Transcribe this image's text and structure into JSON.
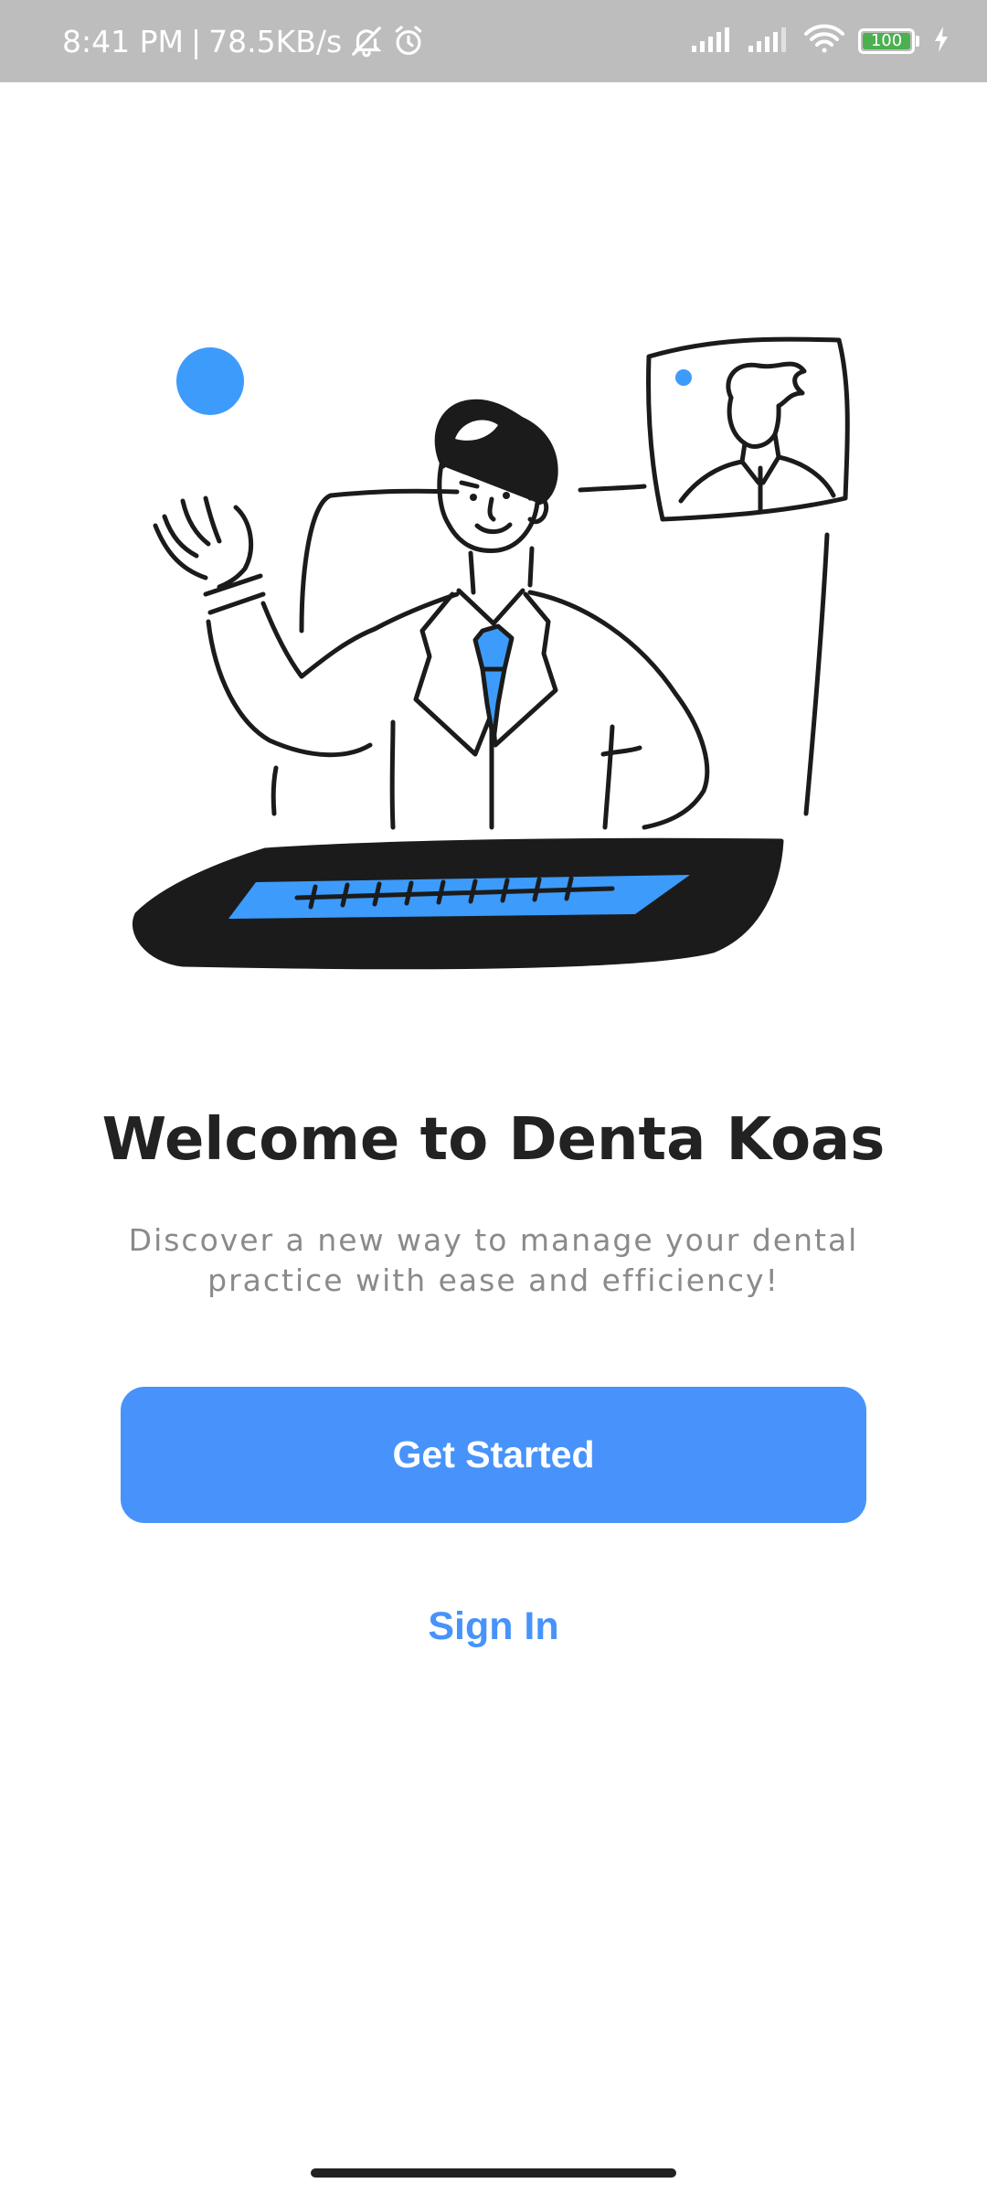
{
  "status_bar": {
    "time": "8:41 PM",
    "separator": "|",
    "network_speed": "78.5KB/s",
    "icons": [
      "bell-off-icon",
      "alarm-icon",
      "signal-icon",
      "signal-icon",
      "wifi-icon",
      "battery-icon",
      "charging-icon"
    ],
    "battery_level": "100",
    "battery_color": "#4caf50"
  },
  "illustration": {
    "icon": "doctor-telehealth-illustration",
    "accent_color": "#3d9bfb",
    "ink_color": "#1b1b1b"
  },
  "onboarding": {
    "title": "Welcome to Denta Koas",
    "subtitle_line1": "Discover a new way to manage your dental",
    "subtitle_line2": "practice with ease and efficiency!",
    "get_started_label": "Get Started",
    "sign_in_label": "Sign In",
    "primary_color": "#4793fb"
  }
}
